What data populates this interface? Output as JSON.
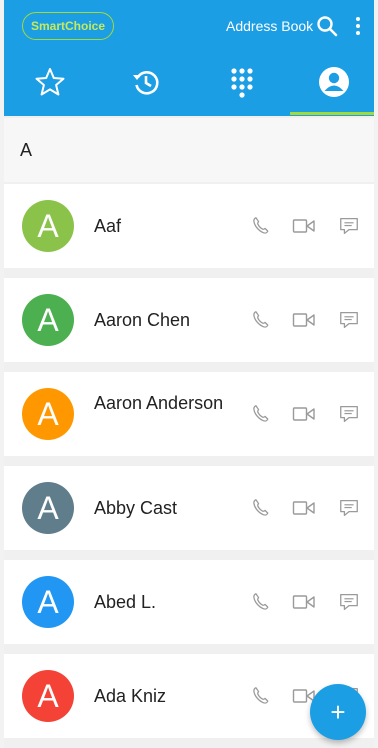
{
  "header": {
    "badge": "SmartChoice",
    "title": "Address Book",
    "tabs": [
      {
        "name": "favorites",
        "icon": "star-icon"
      },
      {
        "name": "recents",
        "icon": "history-icon"
      },
      {
        "name": "dialpad",
        "icon": "dialpad-icon"
      },
      {
        "name": "contacts",
        "icon": "contact-icon",
        "selected": true
      }
    ]
  },
  "section": {
    "letter": "A"
  },
  "contacts": [
    {
      "initial": "A",
      "name": "Aaf",
      "color": "#8bc34a"
    },
    {
      "initial": "A",
      "name": "Aaron Chen",
      "color": "#4caf50"
    },
    {
      "initial": "A",
      "name": "Aaron Anderson",
      "color": "#ff9800"
    },
    {
      "initial": "A",
      "name": "Abby Cast",
      "color": "#607d8b"
    },
    {
      "initial": "A",
      "name": "Abed L.",
      "color": "#2196f3"
    },
    {
      "initial": "A",
      "name": "Ada Kniz",
      "color": "#f44336"
    }
  ],
  "fab": {
    "label": "+"
  },
  "colors": {
    "primary": "#1b9ee4",
    "accent": "#a4d93a"
  }
}
